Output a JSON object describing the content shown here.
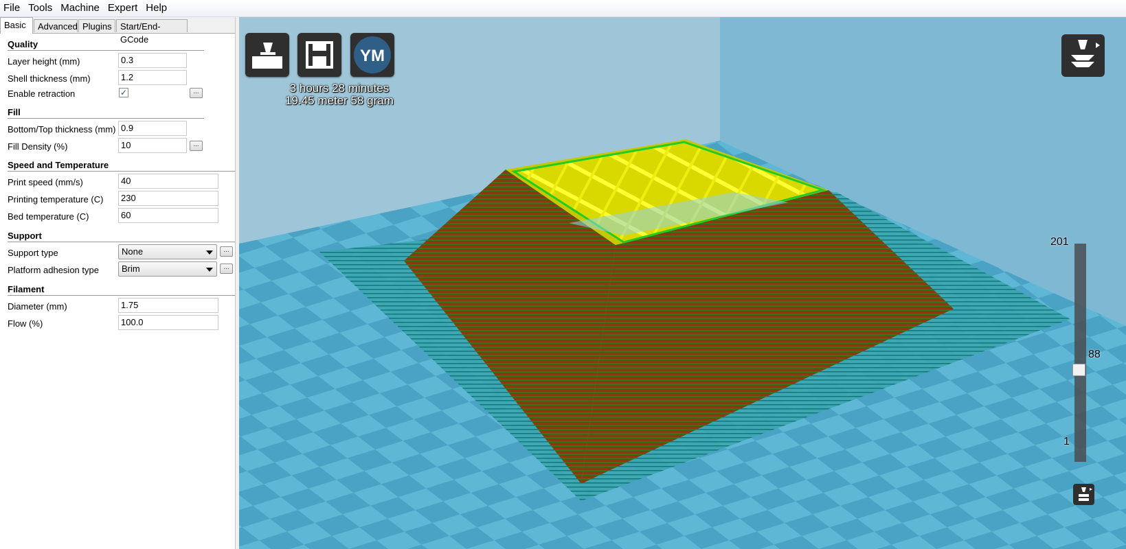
{
  "menu": [
    "File",
    "Tools",
    "Machine",
    "Expert",
    "Help"
  ],
  "tabs": [
    "Basic",
    "Advanced",
    "Plugins",
    "Start/End-GCode"
  ],
  "quality": {
    "title": "Quality",
    "layer_height_label": "Layer height (mm)",
    "layer_height_value": "0.3",
    "shell_thickness_label": "Shell thickness (mm)",
    "shell_thickness_value": "1.2",
    "enable_retraction_label": "Enable retraction",
    "enable_retraction_checked": true
  },
  "fill": {
    "title": "Fill",
    "bottom_top_label": "Bottom/Top thickness (mm)",
    "bottom_top_value": "0.9",
    "fill_density_label": "Fill Density (%)",
    "fill_density_value": "10"
  },
  "speed": {
    "title": "Speed and Temperature",
    "print_speed_label": "Print speed (mm/s)",
    "print_speed_value": "40",
    "print_temp_label": "Printing temperature (C)",
    "print_temp_value": "230",
    "bed_temp_label": "Bed temperature (C)",
    "bed_temp_value": "60"
  },
  "support": {
    "title": "Support",
    "support_type_label": "Support type",
    "support_type_value": "None",
    "adhesion_label": "Platform adhesion type",
    "adhesion_value": "Brim"
  },
  "filament": {
    "title": "Filament",
    "diameter_label": "Diameter (mm)",
    "diameter_value": "1.75",
    "flow_label": "Flow (%)",
    "flow_value": "100.0"
  },
  "dots_label": "...",
  "viewport": {
    "ym_label": "YM",
    "print_time": "3 hours 28 minutes",
    "print_material": "19.45 meter 58 gram",
    "layer_max": "201",
    "layer_current": "88",
    "layer_min": "1",
    "icons": [
      "load-model-icon",
      "save-gcode-icon",
      "youmagine-icon",
      "view-mode-icon"
    ]
  },
  "colors": {
    "bed_light": "#5fb7d6",
    "bed_dark": "#4aa2c4",
    "model_wall": "#8a3a12",
    "model_infill": "#f0f000",
    "brim": "#0e8a8a"
  }
}
